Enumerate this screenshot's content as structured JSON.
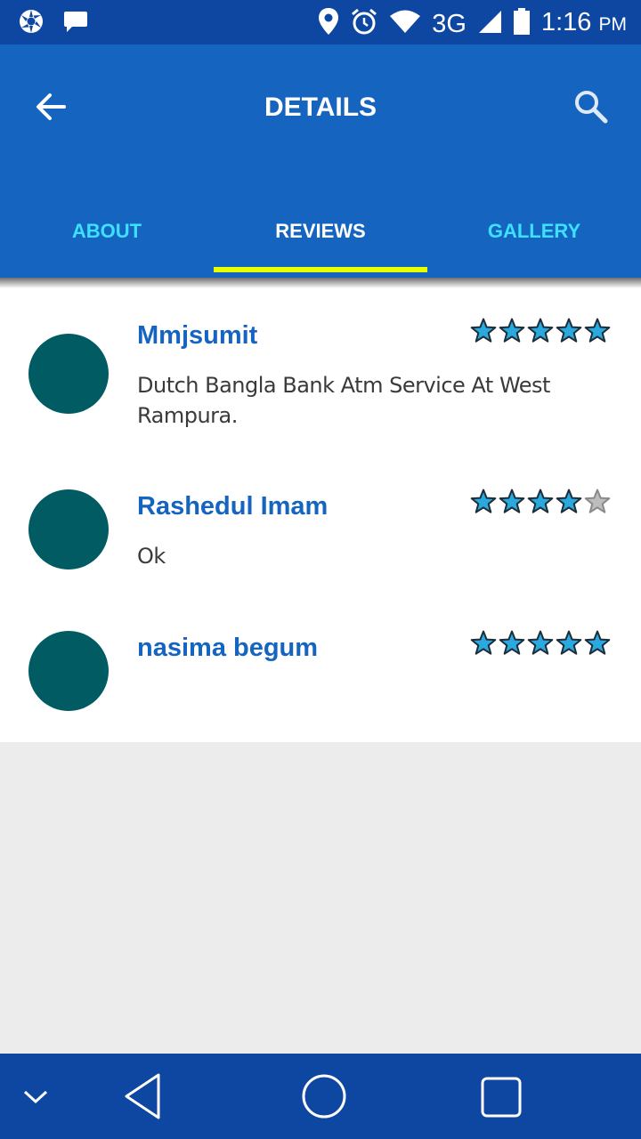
{
  "status_bar": {
    "network": "3G",
    "time": "1:16",
    "ampm": "PM"
  },
  "app_bar": {
    "title": "DETAILS"
  },
  "tabs": [
    {
      "label": "ABOUT",
      "active": false
    },
    {
      "label": "REVIEWS",
      "active": true
    },
    {
      "label": "GALLERY",
      "active": false
    }
  ],
  "reviews": [
    {
      "name": "Mmjsumit",
      "text": "Dutch Bangla Bank  Atm Service At West Rampura.",
      "rating": 5
    },
    {
      "name": "Rashedul Imam",
      "text": "Ok",
      "rating": 4
    },
    {
      "name": "nasima begum",
      "text": "",
      "rating": 5
    }
  ],
  "colors": {
    "status_bar": "#0d47a1",
    "app_bar": "#1565c0",
    "tab_inactive": "#3ee0ff",
    "tab_indicator": "#eaff00",
    "avatar": "#005b63",
    "reviewer_name": "#1565c0",
    "star_filled": "#29a9e0",
    "star_empty": "#bdbdbd"
  },
  "icons": {
    "status_left": [
      "aperture-icon",
      "chat-bubble-icon"
    ],
    "status_right": [
      "location-pin-icon",
      "alarm-clock-icon",
      "wifi-icon",
      "cell-signal-icon",
      "battery-icon"
    ],
    "app_bar": [
      "back-arrow-icon",
      "search-icon"
    ],
    "nav": [
      "chevron-down-icon",
      "back-triangle-icon",
      "home-circle-icon",
      "recents-square-icon"
    ]
  }
}
